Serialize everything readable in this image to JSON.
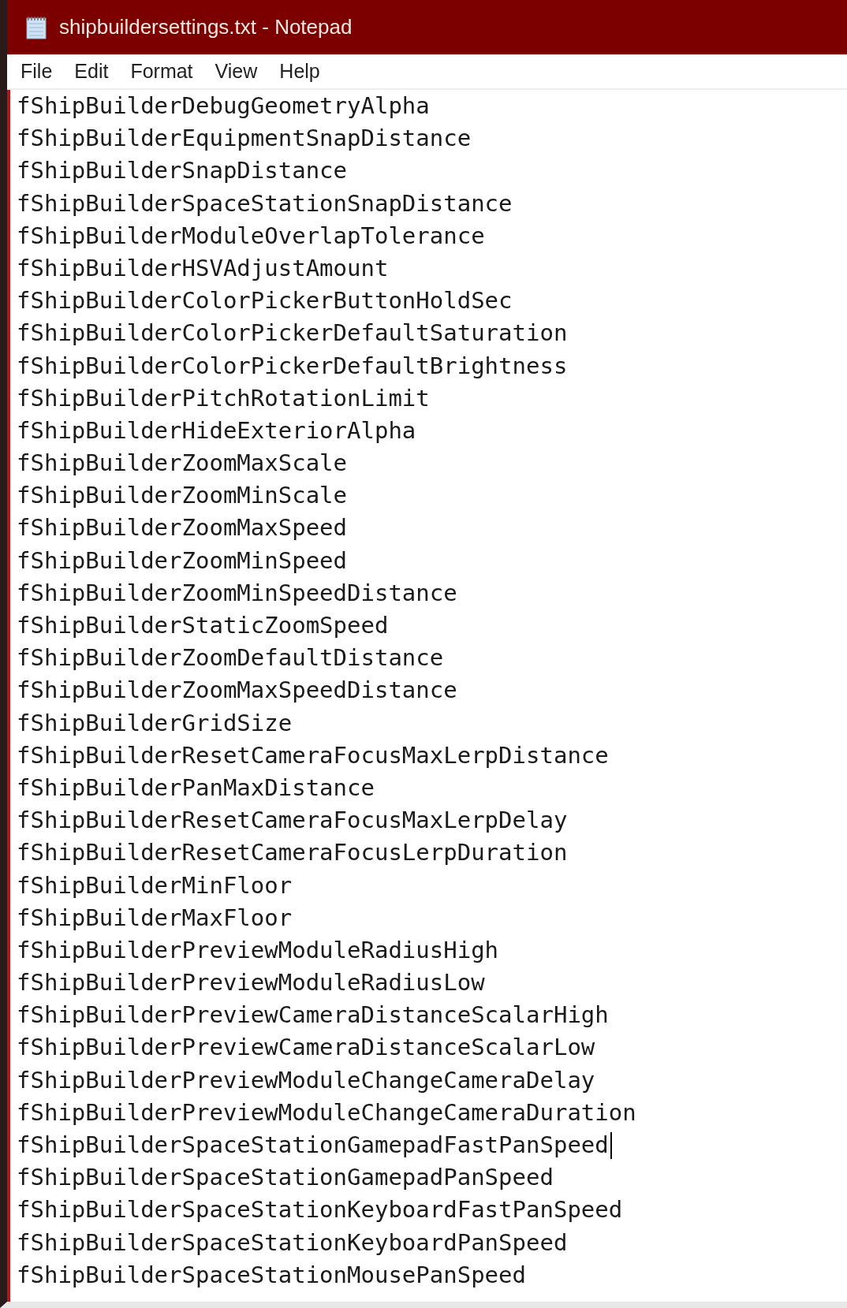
{
  "window": {
    "title": "shipbuildersettings.txt - Notepad"
  },
  "menu": [
    "File",
    "Edit",
    "Format",
    "View",
    "Help"
  ],
  "lines": [
    {
      "text": "fShipBuilderDebugGeometryAlpha",
      "caret": false
    },
    {
      "text": "fShipBuilderEquipmentSnapDistance",
      "caret": false
    },
    {
      "text": "fShipBuilderSnapDistance",
      "caret": false
    },
    {
      "text": "fShipBuilderSpaceStationSnapDistance",
      "caret": false
    },
    {
      "text": "fShipBuilderModuleOverlapTolerance",
      "caret": false
    },
    {
      "text": "fShipBuilderHSVAdjustAmount",
      "caret": false
    },
    {
      "text": "fShipBuilderColorPickerButtonHoldSec",
      "caret": false
    },
    {
      "text": "fShipBuilderColorPickerDefaultSaturation",
      "caret": false
    },
    {
      "text": "fShipBuilderColorPickerDefaultBrightness",
      "caret": false
    },
    {
      "text": "fShipBuilderPitchRotationLimit",
      "caret": false
    },
    {
      "text": "fShipBuilderHideExteriorAlpha",
      "caret": false
    },
    {
      "text": "fShipBuilderZoomMaxScale",
      "caret": false
    },
    {
      "text": "fShipBuilderZoomMinScale",
      "caret": false
    },
    {
      "text": "fShipBuilderZoomMaxSpeed",
      "caret": false
    },
    {
      "text": "fShipBuilderZoomMinSpeed",
      "caret": false
    },
    {
      "text": "fShipBuilderZoomMinSpeedDistance",
      "caret": false
    },
    {
      "text": "fShipBuilderStaticZoomSpeed",
      "caret": false
    },
    {
      "text": "fShipBuilderZoomDefaultDistance",
      "caret": false
    },
    {
      "text": "fShipBuilderZoomMaxSpeedDistance",
      "caret": false
    },
    {
      "text": "fShipBuilderGridSize",
      "caret": false
    },
    {
      "text": "fShipBuilderResetCameraFocusMaxLerpDistance",
      "caret": false
    },
    {
      "text": "fShipBuilderPanMaxDistance",
      "caret": false
    },
    {
      "text": "fShipBuilderResetCameraFocusMaxLerpDelay",
      "caret": false
    },
    {
      "text": "fShipBuilderResetCameraFocusLerpDuration",
      "caret": false
    },
    {
      "text": "fShipBuilderMinFloor",
      "caret": false
    },
    {
      "text": "fShipBuilderMaxFloor",
      "caret": false
    },
    {
      "text": "fShipBuilderPreviewModuleRadiusHigh",
      "caret": false
    },
    {
      "text": "fShipBuilderPreviewModuleRadiusLow",
      "caret": false
    },
    {
      "text": "fShipBuilderPreviewCameraDistanceScalarHigh",
      "caret": false
    },
    {
      "text": "fShipBuilderPreviewCameraDistanceScalarLow",
      "caret": false
    },
    {
      "text": "fShipBuilderPreviewModuleChangeCameraDelay",
      "caret": false
    },
    {
      "text": "fShipBuilderPreviewModuleChangeCameraDuration",
      "caret": false
    },
    {
      "text": "fShipBuilderSpaceStationGamepadFastPanSpeed",
      "caret": true
    },
    {
      "text": "fShipBuilderSpaceStationGamepadPanSpeed",
      "caret": false
    },
    {
      "text": "fShipBuilderSpaceStationKeyboardFastPanSpeed",
      "caret": false
    },
    {
      "text": "fShipBuilderSpaceStationKeyboardPanSpeed",
      "caret": false
    },
    {
      "text": "fShipBuilderSpaceStationMousePanSpeed",
      "caret": false
    }
  ]
}
